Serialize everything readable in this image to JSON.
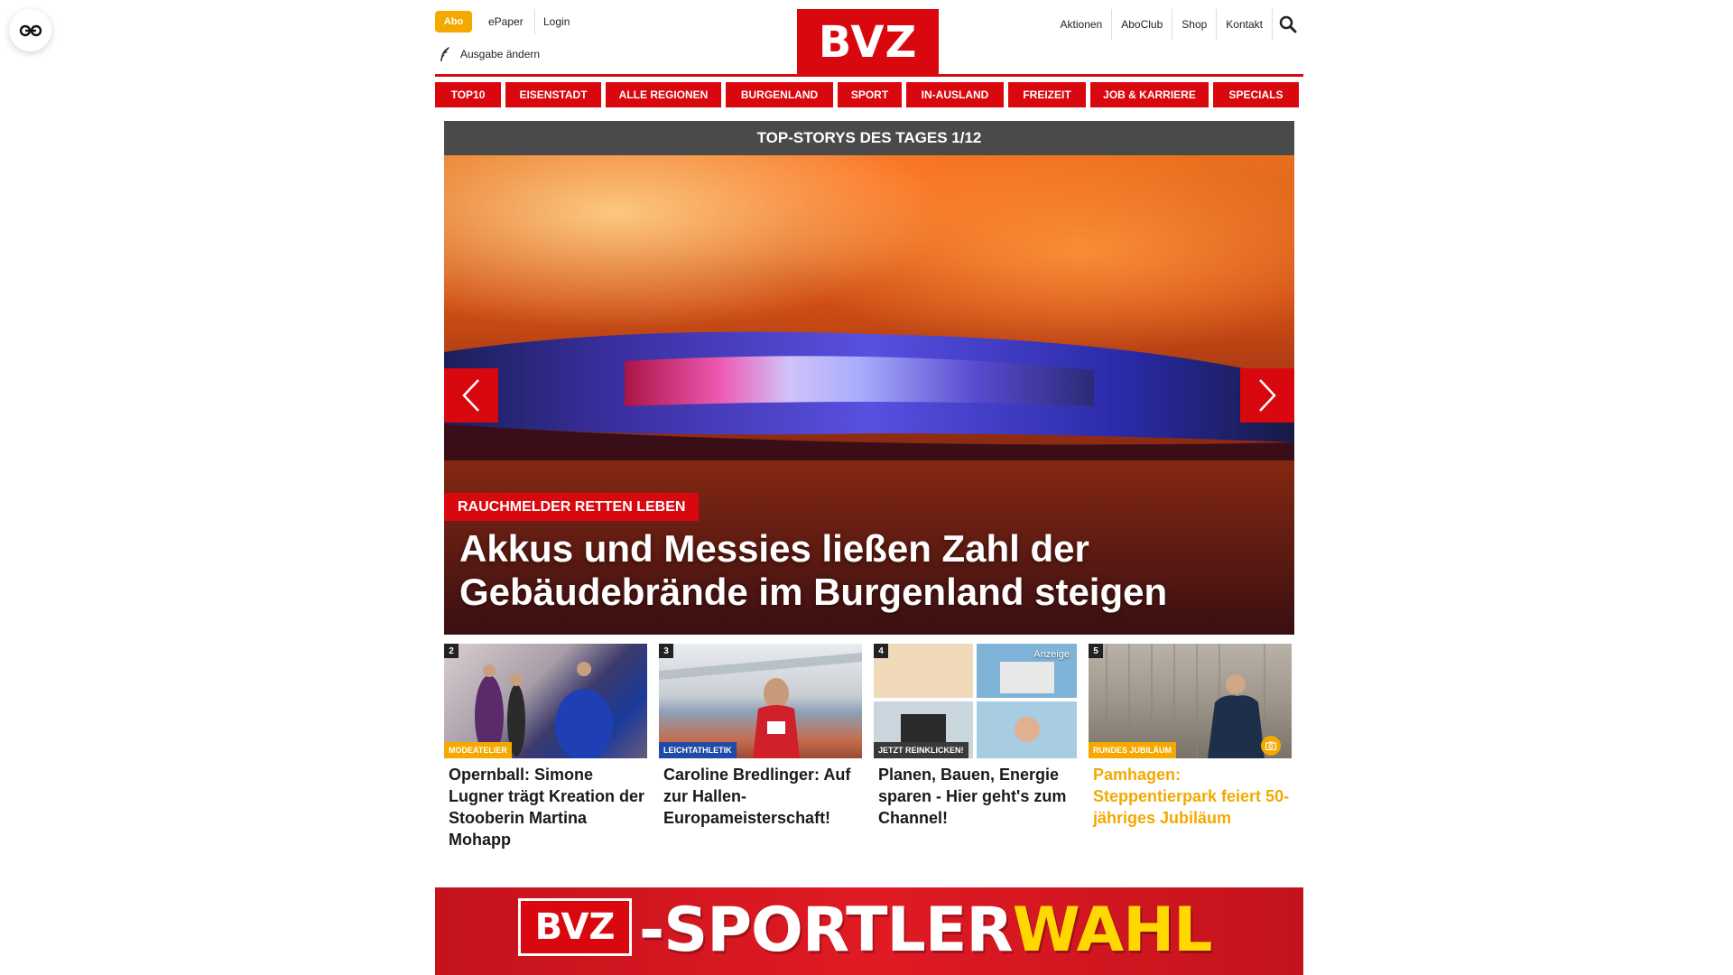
{
  "header": {
    "abo": "Abo",
    "epaper": "ePaper",
    "login": "Login",
    "ausgabe": "Ausgabe ändern",
    "logo": "BVZ",
    "right_links": [
      "Aktionen",
      "AboClub",
      "Shop",
      "Kontakt"
    ]
  },
  "nav": [
    {
      "label": "TOP10"
    },
    {
      "label": "EISENSTADT"
    },
    {
      "label": "ALLE REGIONEN"
    },
    {
      "label": "BURGENLAND"
    },
    {
      "label": "SPORT"
    },
    {
      "label": "IN-AUSLAND"
    },
    {
      "label": "FREIZEIT"
    },
    {
      "label": "JOB & KARRIERE"
    },
    {
      "label": "SPECIALS"
    }
  ],
  "topstories": {
    "heading": "TOP-STORYS DES TAGES 1/12",
    "hero": {
      "category": "RAUCHMELDER RETTEN LEBEN",
      "title": "Akkus und Messies ließen Zahl der Gebäudebrände im Burgenland steigen"
    }
  },
  "teasers": [
    {
      "num": "2",
      "category": "MODEATELIER",
      "title": "Opernball: Simone Lugner trägt Kreation der Stooberin Martina Mohapp",
      "cat_color": "#f3a900",
      "title_color": "#1a1a1a"
    },
    {
      "num": "3",
      "category": "LEICHTATHLETIK",
      "title": "Caroline Bredlinger: Auf zur Hallen-Europameisterschaft!",
      "cat_color": "#1f4aa8",
      "title_color": "#1a1a1a"
    },
    {
      "num": "4",
      "category": "JETZT REINKLICKEN!",
      "title": "Planen, Bauen, Energie sparen - Hier geht's zum Channel!",
      "cat_color": "#3a3a3a",
      "title_color": "#1a1a1a",
      "anzeige": "Anzeige"
    },
    {
      "num": "5",
      "category": "RUNDES JUBILÄUM",
      "title": "Pamhagen: Steppentierpark feiert 50-jähriges Jubiläum",
      "cat_color": "#f3a900",
      "title_color": "#f3a900"
    }
  ],
  "banner": {
    "logo": "BVZ",
    "text_white": "-SPORTLER",
    "text_yellow": "WAHL"
  },
  "colors": {
    "brand_red": "#d9080f",
    "accent_orange": "#f3a900",
    "dark_bar": "#4a4a4a"
  },
  "icons": [
    "reader-mode-icon",
    "search-icon",
    "feather-icon",
    "chevron-left-icon",
    "chevron-right-icon",
    "camera-icon"
  ]
}
